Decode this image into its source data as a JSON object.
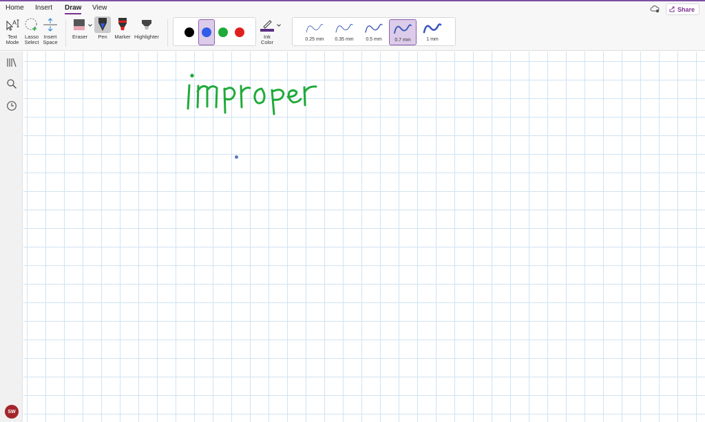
{
  "menu": {
    "home": "Home",
    "insert": "Insert",
    "draw": "Draw",
    "view": "View"
  },
  "share_label": "Share",
  "ribbon": {
    "text_mode": [
      "Text",
      "Mode"
    ],
    "lasso_select": [
      "Lasso",
      "Select"
    ],
    "insert_space": [
      "Insert",
      "Space"
    ],
    "eraser": "Eraser",
    "pen": "Pen",
    "marker": "Marker",
    "highlighter": "Highlighter",
    "ink_color": [
      "Ink",
      "Color"
    ]
  },
  "colors": [
    {
      "name": "black",
      "hex": "#000000",
      "selected": false
    },
    {
      "name": "blue",
      "hex": "#2f5de8",
      "selected": true
    },
    {
      "name": "green",
      "hex": "#1faa3a",
      "selected": false
    },
    {
      "name": "red",
      "hex": "#e02020",
      "selected": false
    }
  ],
  "thicknesses": [
    {
      "label": "0.25 mm",
      "selected": false
    },
    {
      "label": "0.35 mm",
      "selected": false
    },
    {
      "label": "0.5 mm",
      "selected": false
    },
    {
      "label": "0.7 mm",
      "selected": true
    },
    {
      "label": "1 mm",
      "selected": false
    }
  ],
  "avatar_initials": "SW",
  "accent_color": "#7b2f8f",
  "canvas_ink_text": "improper",
  "ink_color_hex": "#1faa3a"
}
